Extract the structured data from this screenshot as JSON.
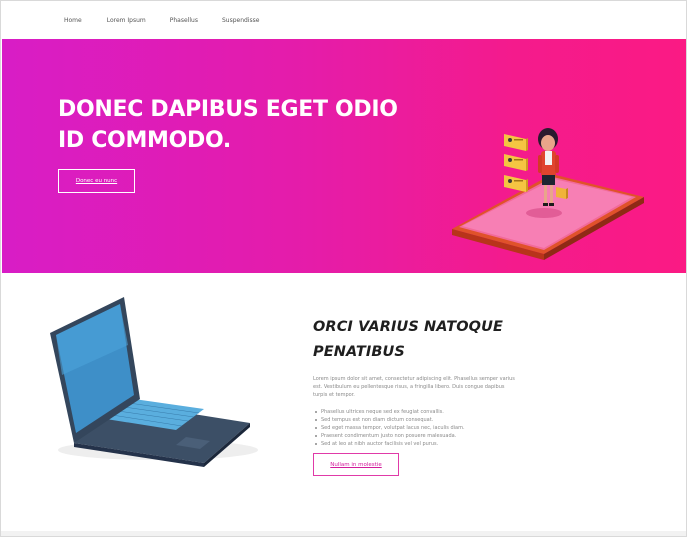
{
  "nav": {
    "items": [
      "Home",
      "Lorem Ipsum",
      "Phasellus",
      "Suspendisse"
    ]
  },
  "hero": {
    "title": "DONEC DAPIBUS EGET ODIO ID COMMODO.",
    "button_label": "Donec eu nunc",
    "illustration": "smartphone-with-woman-and-chat-cards",
    "colors": {
      "gradient_start": "#d81dc6",
      "gradient_end": "#fb1a84"
    }
  },
  "section": {
    "illustration": "laptop",
    "title": "ORCI VARIUS NATOQUE PENATIBUS",
    "paragraph": "Lorem ipsum dolor sit amet, consectetur adipiscing elit. Phasellus semper varius est. Vestibulum eu pellentesque risus, a fringilla libero. Duis congue dapibus turpis et tempor.",
    "list": [
      "Phasellus ultrices neque sed ex feugiat convallis.",
      "Sed tempus est non diam dictum consequat.",
      "Sed eget massa tempor, volutpat lacus nec, iaculis diam.",
      "Praesent condimentum justo non posuere malesuada.",
      "Sed at leo at nibh auctor facilisis vel vel purus."
    ],
    "button_label": "Nullam in molestie",
    "accent_color": "#e03aa8"
  }
}
